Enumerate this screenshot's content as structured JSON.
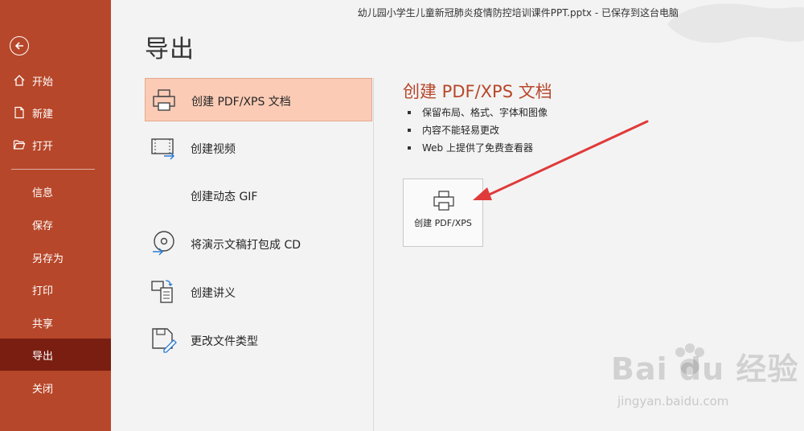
{
  "window": {
    "document_title": "幼儿园小学生儿童新冠肺炎疫情防控培训课件PPT.pptx  -  已保存到这台电脑"
  },
  "sidebar": {
    "back_icon": "arrow-left-circle-icon",
    "items": [
      {
        "label": "开始",
        "icon": "home-icon"
      },
      {
        "label": "新建",
        "icon": "new-file-icon"
      },
      {
        "label": "打开",
        "icon": "folder-open-icon"
      },
      {
        "label": "信息"
      },
      {
        "label": "保存"
      },
      {
        "label": "另存为"
      },
      {
        "label": "打印"
      },
      {
        "label": "共享"
      },
      {
        "label": "导出",
        "active": true
      },
      {
        "label": "关闭"
      }
    ]
  },
  "page": {
    "title": "导出"
  },
  "export_options": [
    {
      "label": "创建 PDF/XPS 文档",
      "icon": "printer-icon",
      "selected": true
    },
    {
      "label": "创建视频",
      "icon": "video-icon"
    },
    {
      "label": "创建动态 GIF"
    },
    {
      "label": "将演示文稿打包成 CD",
      "icon": "disc-icon"
    },
    {
      "label": "创建讲义",
      "icon": "handout-icon"
    },
    {
      "label": "更改文件类型",
      "icon": "change-type-icon"
    }
  ],
  "detail": {
    "title": "创建 PDF/XPS 文档",
    "bullets": [
      "保留布局、格式、字体和图像",
      "内容不能轻易更改",
      "Web 上提供了免费查看器"
    ],
    "button_label": "创建 PDF/XPS"
  },
  "watermark": {
    "logo": "Bai du 经验",
    "url": "jingyan.baidu.com"
  },
  "colors": {
    "sidebar": "#b7472a",
    "sidebar_active": "#7a1e12",
    "selected_option": "#fbcbb5",
    "accent_title": "#b7472a",
    "annotation_arrow": "#e03a3a"
  }
}
